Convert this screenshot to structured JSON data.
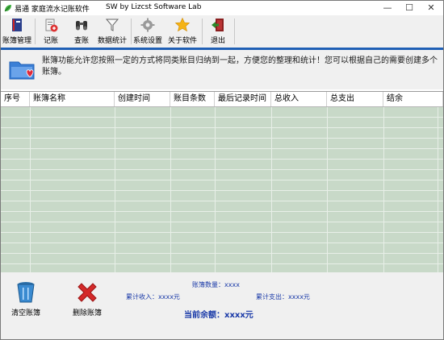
{
  "window": {
    "app_name": "易通",
    "title": "家庭流水记账软件",
    "subtitle": "SW   by Lizcst Software Lab",
    "minimize": "—",
    "maximize": "☐",
    "close": "✕"
  },
  "toolbar": {
    "items": [
      {
        "label": "账簿管理",
        "icon": "ledger-book-icon"
      },
      {
        "label": "记账",
        "icon": "add-record-icon"
      },
      {
        "label": "查账",
        "icon": "binoculars-icon"
      },
      {
        "label": "数据统计",
        "icon": "funnel-icon"
      },
      {
        "label": "系统设置",
        "icon": "gear-icon"
      },
      {
        "label": "关于软件",
        "icon": "star-icon"
      },
      {
        "label": "退出",
        "icon": "exit-door-icon"
      }
    ]
  },
  "info": {
    "icon": "folder-heart-icon",
    "text": "账簿功能允许您按照一定的方式将同类账目归纳到一起，方便您的整理和统计！您可以根据自己的需要创建多个账簿。"
  },
  "table": {
    "columns": [
      "序号",
      "账簿名称",
      "创建时间",
      "账目条数",
      "最后记录时间",
      "总收入",
      "总支出",
      "结余"
    ],
    "rows": []
  },
  "bottom": {
    "clear_label": "清空账簿",
    "delete_label": "删除账簿",
    "count_text": "账簿数量：xxxx",
    "income_text": "累计收入：xxxx元",
    "expense_text": "累计支出：xxxx元",
    "balance_text": "当前余额：xxxx元"
  },
  "colors": {
    "accent": "#1f5fb5",
    "grid_bg": "#c8d9c8",
    "stat_text": "#1a3aa8"
  }
}
